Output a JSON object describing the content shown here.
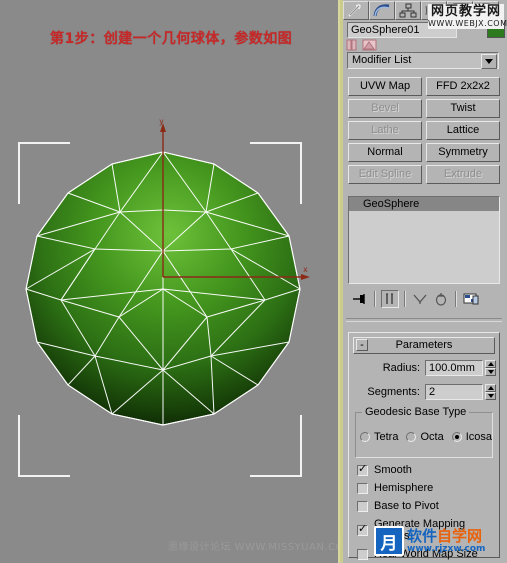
{
  "viewport": {
    "annotation": "第1步：创建一个几何球体，参数如图",
    "axis_y_label": "y",
    "axis_x_label": "x",
    "object_color": "#2d7a1e",
    "background_color": "#8a8a8a",
    "active_border_color": "#cbcb8e",
    "watermark_bottom": "思缘设计论坛 WWW.MISSYUAN.COM"
  },
  "watermarks": {
    "top_right_cn": "网页教学网",
    "top_right_en": "WWW.WEBJX.COM",
    "logo_mark": "月",
    "logo_cn_a": "软件",
    "logo_cn_b": "自学网",
    "logo_url": "www.rjzxw.com"
  },
  "panel": {
    "tabs": [
      {
        "name": "create-tab",
        "icon": "arrow-star-icon"
      },
      {
        "name": "modify-tab",
        "icon": "curve-arc-icon"
      },
      {
        "name": "hierarchy-tab",
        "icon": "hierarchy-icon"
      },
      {
        "name": "motion-tab",
        "icon": "motion-wheel-icon"
      },
      {
        "name": "display-tab",
        "icon": "display-icon"
      },
      {
        "name": "utilities-tab",
        "icon": "hammer-icon"
      }
    ],
    "object_name": "GeoSphere01",
    "modifier_list_label": "Modifier List",
    "modifier_buttons": [
      {
        "label": "UVW Map",
        "disabled": false
      },
      {
        "label": "FFD 2x2x2",
        "disabled": false
      },
      {
        "label": "Bevel",
        "disabled": true
      },
      {
        "label": "Twist",
        "disabled": false
      },
      {
        "label": "Lathe",
        "disabled": true
      },
      {
        "label": "Lattice",
        "disabled": false
      },
      {
        "label": "Normal",
        "disabled": false
      },
      {
        "label": "Symmetry",
        "disabled": false
      },
      {
        "label": "Edit Spline",
        "disabled": true
      },
      {
        "label": "Extrude",
        "disabled": true
      }
    ],
    "stack": [
      {
        "label": "GeoSphere",
        "selected": true
      }
    ],
    "stack_tools": [
      {
        "name": "pin-stack-icon",
        "pressed": false
      },
      {
        "name": "show-end-result-icon",
        "pressed": true
      },
      {
        "name": "make-unique-icon",
        "pressed": false
      },
      {
        "name": "remove-modifier-icon",
        "pressed": false
      },
      {
        "name": "configure-sets-icon",
        "pressed": false
      }
    ],
    "rollout": {
      "title": "Parameters",
      "collapse_glyph": "-",
      "radius_label": "Radius:",
      "radius_value": "100.0mm",
      "segments_label": "Segments:",
      "segments_value": "2",
      "geodesic_group_title": "Geodesic Base Type",
      "geodesic_options": [
        {
          "label": "Tetra",
          "selected": false
        },
        {
          "label": "Octa",
          "selected": false
        },
        {
          "label": "Icosa",
          "selected": true
        }
      ],
      "checkboxes": [
        {
          "label": "Smooth",
          "checked": true
        },
        {
          "label": "Hemisphere",
          "checked": false
        },
        {
          "label": "Base to Pivot",
          "checked": false
        },
        {
          "label": "Generate Mapping Coords.",
          "checked": true
        },
        {
          "label": "Real-World Map Size",
          "checked": false
        }
      ]
    }
  }
}
